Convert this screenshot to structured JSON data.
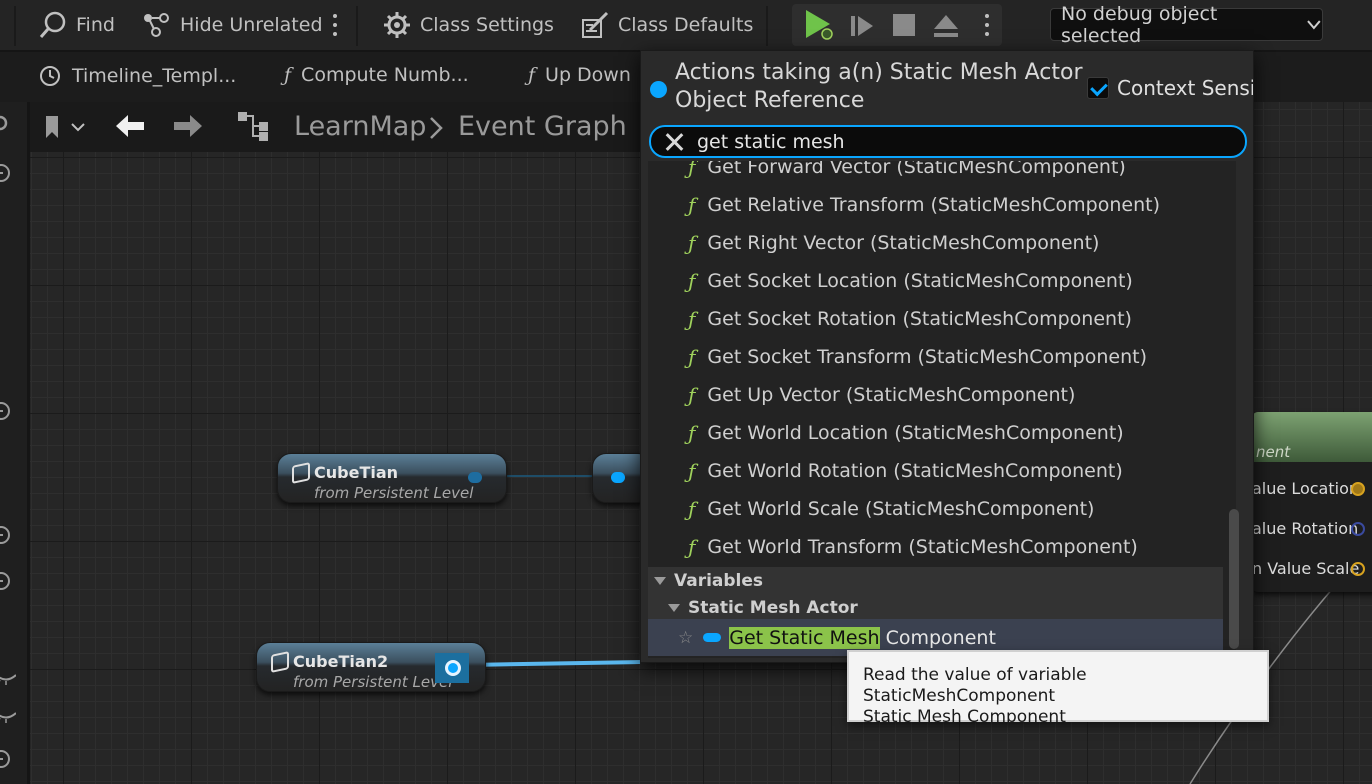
{
  "toolbar": {
    "find_label": "Find",
    "hide_unrelated_label": "Hide Unrelated",
    "class_settings_label": "Class Settings",
    "class_defaults_label": "Class Defaults",
    "debug_select_value": "No debug object selected"
  },
  "tabs": [
    {
      "label": "Timeline_Templ...",
      "icon": "clock-icon"
    },
    {
      "label": "Compute Numb...",
      "icon": "function-icon"
    },
    {
      "label": "Up Down",
      "icon": "function-icon"
    }
  ],
  "graph_header": {
    "crumb_map": "LearnMap",
    "crumb_graph": "Event Graph"
  },
  "nodes": {
    "cube1": {
      "title": "CubeTian",
      "subtitle": "from Persistent Level"
    },
    "cube2": {
      "title": "CubeTian2",
      "subtitle": "from Persistent Level"
    },
    "right": {
      "head_sub": "nent",
      "pins": [
        "alue Location",
        "alue Rotation",
        "n Value Scale"
      ]
    }
  },
  "popup": {
    "title": "Actions taking a(n) Static Mesh Actor Object Reference",
    "context_sensitive_label": "Context Sensitiv",
    "context_sensitive_checked": true,
    "search_value": "get static mesh",
    "function_glyph": "ƒ",
    "results": [
      "Get Forward Vector (StaticMeshComponent)",
      "Get Relative Transform (StaticMeshComponent)",
      "Get Right Vector (StaticMeshComponent)",
      "Get Socket Location (StaticMeshComponent)",
      "Get Socket Rotation (StaticMeshComponent)",
      "Get Socket Transform (StaticMeshComponent)",
      "Get Up Vector (StaticMeshComponent)",
      "Get World Location (StaticMeshComponent)",
      "Get World Rotation (StaticMeshComponent)",
      "Get World Scale (StaticMeshComponent)",
      "Get World Transform (StaticMeshComponent)"
    ],
    "category_variables": "Variables",
    "category_actor": "Static Mesh Actor",
    "selected_highlight": "Get Static Mesh",
    "selected_rest": " Component"
  },
  "tooltip": {
    "line1": "Read the value of variable StaticMeshComponent",
    "line2": "Static Mesh Component"
  },
  "colors": {
    "accent": "#0aa6ff",
    "function_green": "#9fd15c",
    "highlight": "#8bc34a"
  }
}
